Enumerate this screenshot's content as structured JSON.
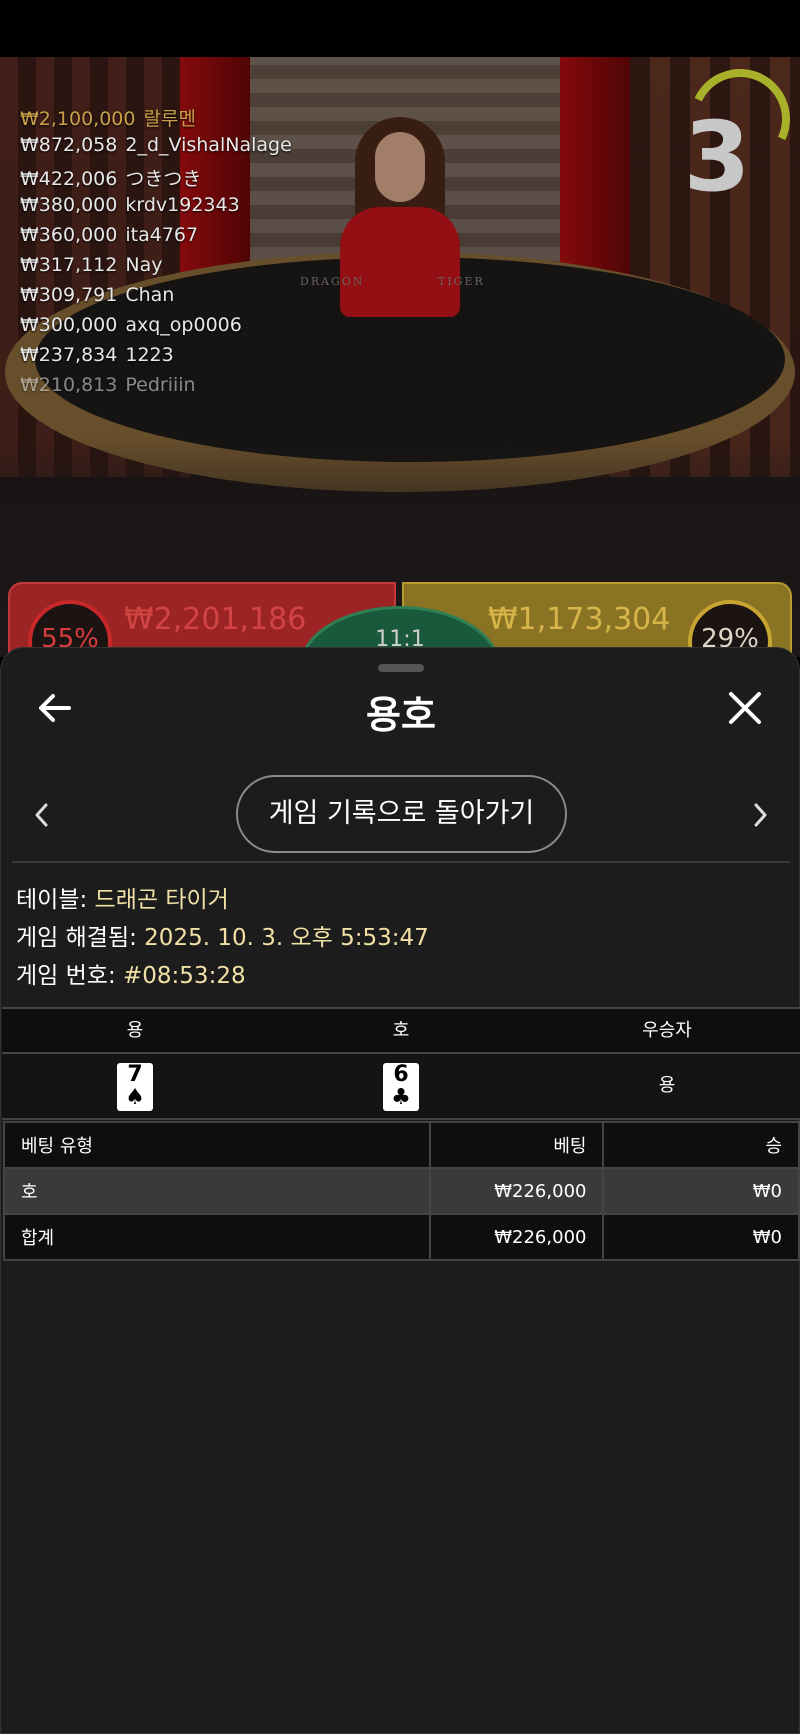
{
  "video": {
    "countdown": "3",
    "table_labels": [
      "DRAGON",
      "TIGER"
    ],
    "leaderboard": [
      {
        "amount": "₩2,100,000",
        "name": "랄루멘"
      },
      {
        "amount": "₩872,058",
        "name": "2_d_VishalNalage"
      },
      {
        "amount": "₩422,006",
        "name": "つきつき"
      },
      {
        "amount": "₩380,000",
        "name": "krdv192343"
      },
      {
        "amount": "₩360,000",
        "name": "ita4767"
      },
      {
        "amount": "₩317,112",
        "name": "Nay"
      },
      {
        "amount": "₩309,791",
        "name": "Chan"
      },
      {
        "amount": "₩300,000",
        "name": "axq_op0006"
      },
      {
        "amount": "₩237,834",
        "name": "1223"
      },
      {
        "amount": "₩210,813",
        "name": "Pedriiin"
      }
    ],
    "dragon_panel": {
      "percent": "55%",
      "total": "₩2,201,186",
      "progress_percent": 55
    },
    "tiger_panel": {
      "percent": "29%",
      "total": "₩1,173,304",
      "progress_percent": 29
    },
    "tie_ratio": "11:1",
    "colors": {
      "dragon": "#9c2424",
      "tiger": "#8a7424",
      "tie": "#1a5a3c"
    }
  },
  "sheet": {
    "title": "용호",
    "back_icon": "arrow-left-icon",
    "close_icon": "close-icon",
    "history_button_label": "게임 기록으로 돌아가기",
    "info": {
      "table_label": "테이블: ",
      "table_value": "드래곤 타이거",
      "resolved_label": "게임 해결됨: ",
      "resolved_value": "2025. 10. 3. 오후 5:53:47",
      "game_no_label": "게임 번호: ",
      "game_no_value": "#08:53:28"
    },
    "result": {
      "headers": [
        "용",
        "호",
        "우승자"
      ],
      "dragon_card": {
        "rank": "7",
        "suit": "♠"
      },
      "tiger_card": {
        "rank": "6",
        "suit": "♣"
      },
      "winner": "용"
    },
    "bets": {
      "headers": [
        "베팅 유형",
        "베팅",
        "승"
      ],
      "rows": [
        {
          "type": "호",
          "bet": "₩226,000",
          "win": "₩0"
        }
      ],
      "total": {
        "type": "합계",
        "bet": "₩226,000",
        "win": "₩0"
      }
    },
    "accent_color": "#f1e0a5"
  }
}
